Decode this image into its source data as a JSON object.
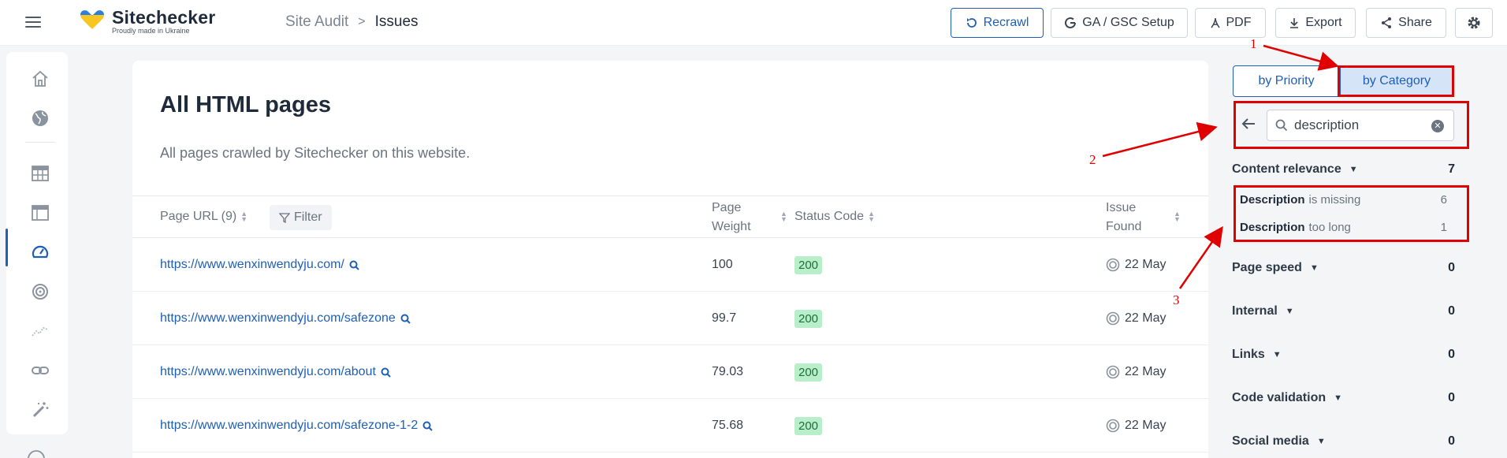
{
  "header": {
    "menu_icon": "hamburger-menu-icon",
    "logo": {
      "name": "Sitechecker",
      "tagline": "Proudly made in Ukraine"
    },
    "breadcrumb": {
      "parent": "Site Audit",
      "separator": ">",
      "current": "Issues"
    },
    "buttons": {
      "recrawl": "Recrawl",
      "ga_gsc": "GA / GSC Setup",
      "pdf": "PDF",
      "export": "Export",
      "share": "Share"
    }
  },
  "sidebar": {
    "icons": [
      "home-icon",
      "globe-icon",
      "table-icon",
      "dashboard-icon",
      "site-audit-gauge-icon",
      "rank-tracker-icon",
      "trend-icon",
      "link-icon",
      "magic-wand-icon"
    ]
  },
  "main": {
    "title": "All HTML pages",
    "description": "All pages crawled by Sitechecker on this website.",
    "table": {
      "columns": {
        "url": "Page URL (9)",
        "filter": "Filter",
        "weight_line1": "Page",
        "weight_line2": "Weight",
        "status": "Status Code",
        "issue_line1": "Issue",
        "issue_line2": "Found"
      },
      "rows": [
        {
          "url": "https://www.wenxinwendyju.com/",
          "weight": "100",
          "status": "200",
          "found": "22 May"
        },
        {
          "url": "https://www.wenxinwendyju.com/safezone",
          "weight": "99.7",
          "status": "200",
          "found": "22 May"
        },
        {
          "url": "https://www.wenxinwendyju.com/about",
          "weight": "79.03",
          "status": "200",
          "found": "22 May"
        },
        {
          "url": "https://www.wenxinwendyju.com/safezone-1-2",
          "weight": "75.68",
          "status": "200",
          "found": "22 May"
        }
      ]
    }
  },
  "right_panel": {
    "toggle": {
      "by_priority": "by Priority",
      "by_category": "by Category",
      "selected": "by Category"
    },
    "search": {
      "value": "description",
      "placeholder": "Search"
    },
    "categories": [
      {
        "name": "Content relevance",
        "count": "7"
      },
      {
        "name": "Page speed",
        "count": "0"
      },
      {
        "name": "Internal",
        "count": "0"
      },
      {
        "name": "Links",
        "count": "0"
      },
      {
        "name": "Code validation",
        "count": "0"
      },
      {
        "name": "Social media",
        "count": "0"
      }
    ],
    "issues": [
      {
        "keyword": "Description",
        "rest": "is missing",
        "count": "6"
      },
      {
        "keyword": "Description",
        "rest": "too long",
        "count": "1"
      }
    ]
  },
  "annotations": {
    "label_1": "1",
    "label_2": "2",
    "label_3": "3",
    "color": "#e00000"
  },
  "colors": {
    "accent": "#1f5fb5",
    "status_ok_bg": "#b9eecb",
    "annotation": "#e00000"
  }
}
